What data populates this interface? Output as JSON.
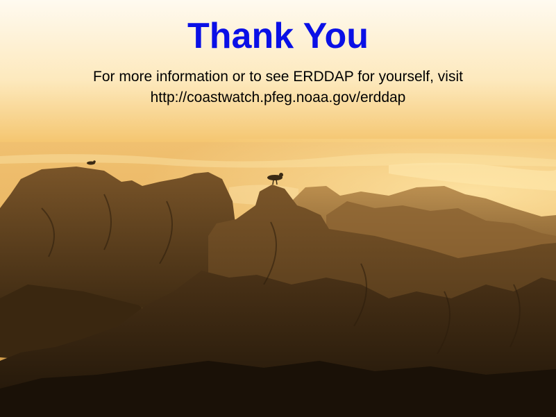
{
  "slide": {
    "title": "Thank You",
    "info_line": "For more information or to see ERDDAP for yourself, visit",
    "url_text": "http://coastwatch.pfeg.noaa.gov/erddap"
  },
  "colors": {
    "title": "#0a10e6",
    "text": "#000000",
    "sky_top": "#fff9ec",
    "sky_horizon": "#f6c56a",
    "sea": "#e7b25a",
    "rocks_near": "#2a1c0d",
    "rocks_far": "#8a6533"
  },
  "photo": {
    "subject": "sunset-over-rocky-coast-with-seagulls"
  }
}
